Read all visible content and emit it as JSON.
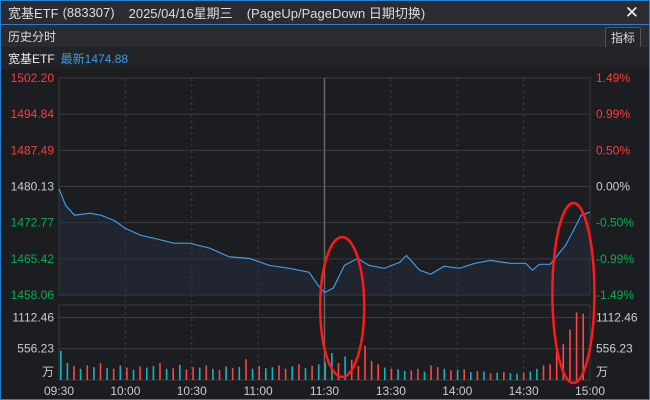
{
  "title": {
    "name": "宽基ETF",
    "code": "(883307)",
    "date": "2025/04/16星期三",
    "hint": "(PageUp/PageDown 日期切换)"
  },
  "toolbar": {
    "label": "历史分时",
    "indicator_button": "指标"
  },
  "info": {
    "name": "宽基ETF",
    "latest": "最新1474.88"
  },
  "colors": {
    "up": "#ff3b3b",
    "down": "#00b050",
    "line": "#3d9be8",
    "vol_up": "#ff4444",
    "vol_down": "#14b3c0",
    "annotation": "#ff1a1a"
  },
  "chart_data": {
    "type": "line",
    "price_axis_left": [
      "1502.20",
      "1494.84",
      "1487.49",
      "1480.13",
      "1472.77",
      "1465.42",
      "1458.06"
    ],
    "price_axis_right": [
      "1.49%",
      "0.99%",
      "0.50%",
      "0.00%",
      "-0.50%",
      "-0.99%",
      "-1.49%"
    ],
    "price_range": [
      1458.06,
      1502.2
    ],
    "prev_close": 1480.13,
    "volume_axis": [
      "1112.46",
      "556.23",
      "万"
    ],
    "volume_range": [
      0,
      1334
    ],
    "x_labels": [
      "09:30",
      "10:00",
      "10:30",
      "11:00",
      "11:30",
      "13:30",
      "14:00",
      "14:30",
      "15:00"
    ],
    "minutes_total": 240,
    "price_points": [
      [
        0,
        1479.7
      ],
      [
        3,
        1476.3
      ],
      [
        7,
        1474.3
      ],
      [
        14,
        1474.7
      ],
      [
        19,
        1474.3
      ],
      [
        25,
        1473.2
      ],
      [
        30,
        1471.6
      ],
      [
        37,
        1470.2
      ],
      [
        43,
        1469.6
      ],
      [
        52,
        1468.6
      ],
      [
        59,
        1468.6
      ],
      [
        68,
        1467.6
      ],
      [
        77,
        1465.8
      ],
      [
        86,
        1465.5
      ],
      [
        95,
        1464.1
      ],
      [
        104,
        1463.5
      ],
      [
        113,
        1462.7
      ],
      [
        117,
        1460.1
      ],
      [
        120,
        1458.5
      ],
      [
        124,
        1459.5
      ],
      [
        129,
        1464.1
      ],
      [
        135,
        1465.5
      ],
      [
        140,
        1464.1
      ],
      [
        147,
        1463.5
      ],
      [
        154,
        1464.7
      ],
      [
        157,
        1466.1
      ],
      [
        163,
        1463.1
      ],
      [
        168,
        1462.3
      ],
      [
        174,
        1463.9
      ],
      [
        181,
        1463.5
      ],
      [
        188,
        1464.5
      ],
      [
        195,
        1465.1
      ],
      [
        204,
        1464.5
      ],
      [
        211,
        1464.5
      ],
      [
        214,
        1463.1
      ],
      [
        217,
        1464.3
      ],
      [
        222,
        1464.3
      ],
      [
        229,
        1468.2
      ],
      [
        233,
        1471.6
      ],
      [
        236,
        1474.3
      ],
      [
        240,
        1474.9
      ]
    ],
    "volume": [
      -520,
      -300,
      250,
      -200,
      260,
      -230,
      300,
      -210,
      200,
      -260,
      220,
      -180,
      240,
      -220,
      -250,
      300,
      -200,
      210,
      -270,
      190,
      230,
      -220,
      260,
      -200,
      180,
      -240,
      210,
      -230,
      370,
      -200,
      250,
      -210,
      -230,
      260,
      200,
      -240,
      280,
      -210,
      250,
      -280,
      -310,
      -480,
      300,
      -420,
      360,
      250,
      610,
      340,
      280,
      -220,
      200,
      -190,
      -160,
      170,
      200,
      -150,
      260,
      230,
      -200,
      170,
      -180,
      190,
      -140,
      160,
      -150,
      120,
      -130,
      140,
      -120,
      -110,
      130,
      -150,
      -200,
      260,
      280,
      500,
      640,
      900,
      1200,
      1180
    ]
  },
  "annotations": [
    {
      "type": "ellipse",
      "minute_center": 128,
      "label": ""
    },
    {
      "type": "ellipse",
      "minute_center": 232,
      "label": ""
    }
  ]
}
